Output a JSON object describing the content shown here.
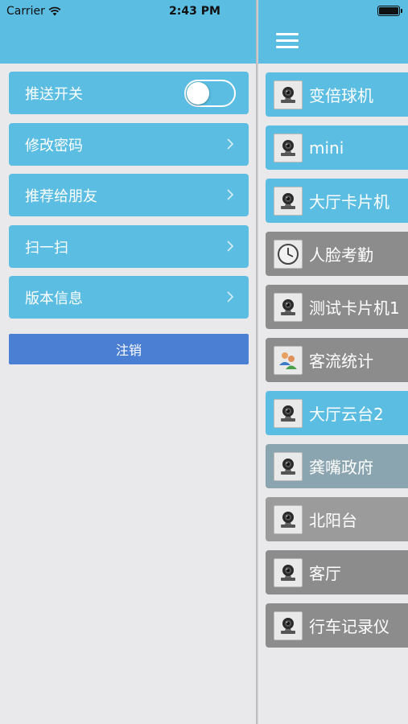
{
  "status_bar": {
    "carrier": "Carrier",
    "time": "2:43 PM"
  },
  "settings_menu": {
    "items": [
      {
        "label": "推送开关",
        "type": "toggle",
        "toggle_on": false
      },
      {
        "label": "修改密码",
        "type": "link"
      },
      {
        "label": "推荐给朋友",
        "type": "link"
      },
      {
        "label": "扫一扫",
        "type": "link"
      },
      {
        "label": "版本信息",
        "type": "link"
      }
    ],
    "logout_label": "注销"
  },
  "device_list": {
    "items": [
      {
        "label": "变倍球机",
        "icon": "camera-icon",
        "color": "#5bbde2"
      },
      {
        "label": "mini",
        "icon": "camera-icon",
        "color": "#5bbde2"
      },
      {
        "label": "大厅卡片机",
        "icon": "camera-icon",
        "color": "#5bbde2"
      },
      {
        "label": "人脸考勤",
        "icon": "clock-icon",
        "color": "#8c8c8c"
      },
      {
        "label": "测试卡片机1",
        "icon": "camera-icon",
        "color": "#8c8c8c"
      },
      {
        "label": "客流统计",
        "icon": "people-icon",
        "color": "#8c8c8c"
      },
      {
        "label": "大厅云台2",
        "icon": "camera-icon",
        "color": "#5bbde2"
      },
      {
        "label": "龚嘴政府",
        "icon": "camera-icon",
        "color": "#8aa4b0"
      },
      {
        "label": "北阳台",
        "icon": "camera-icon",
        "color": "#9b9b9b"
      },
      {
        "label": "客厅",
        "icon": "camera-icon",
        "color": "#8c8c8c"
      },
      {
        "label": "行车记录仪",
        "icon": "camera-icon",
        "color": "#8c8c8c"
      }
    ]
  },
  "colors": {
    "primary": "#5bbde2",
    "logout": "#4a7fd4",
    "background": "#e9e8ea",
    "offline": "#8c8c8c"
  }
}
